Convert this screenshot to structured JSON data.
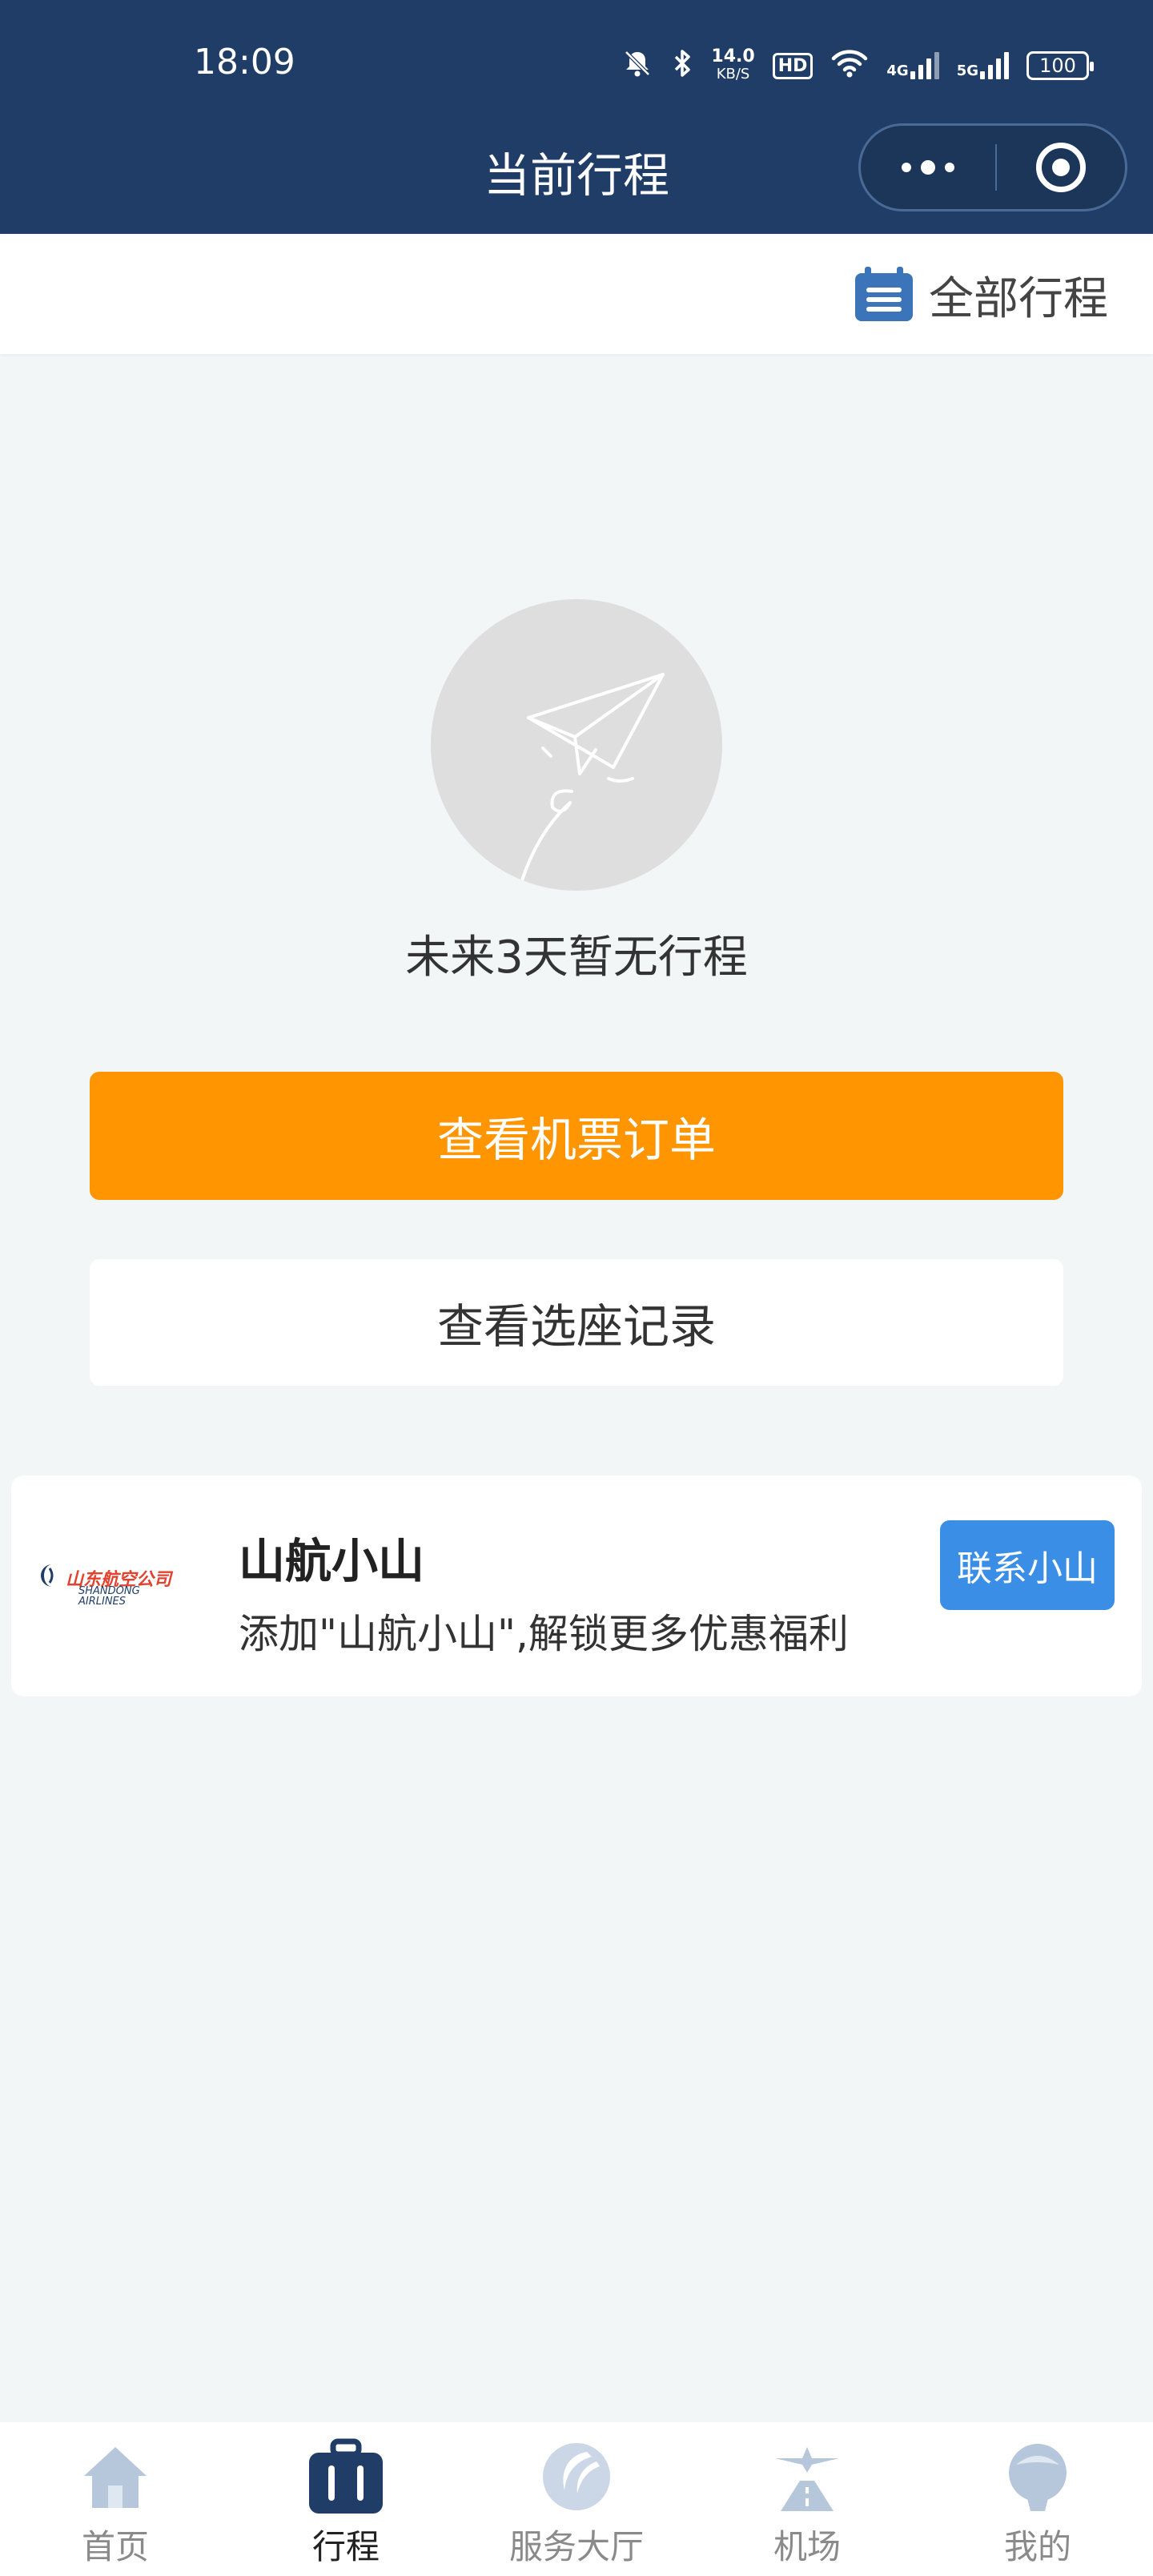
{
  "status_bar": {
    "time": "18:09",
    "net_speed_value": "14.0",
    "net_speed_unit": "KB/S",
    "hd_label": "HD",
    "signal_4g": "4G",
    "signal_5g": "5G",
    "battery": "100"
  },
  "header": {
    "title": "当前行程"
  },
  "subbar": {
    "all_trips_label": "全部行程"
  },
  "empty_state": {
    "message": "未来3天暂无行程"
  },
  "actions": {
    "view_orders_label": "查看机票订单",
    "view_seats_label": "查看选座记录"
  },
  "promo": {
    "logo_cn": "山东航空公司",
    "logo_en_line1": "SHANDONG",
    "logo_en_line2": "AIRLINES",
    "title": "山航小山",
    "description": "添加\"山航小山\",解锁更多优惠福利",
    "button_label": "联系小山"
  },
  "tabbar": {
    "items": [
      {
        "label": "首页",
        "icon": "home-icon",
        "active": false
      },
      {
        "label": "行程",
        "icon": "suitcase-icon",
        "active": true
      },
      {
        "label": "服务大厅",
        "icon": "service-hall-icon",
        "active": false
      },
      {
        "label": "机场",
        "icon": "airport-icon",
        "active": false
      },
      {
        "label": "我的",
        "icon": "profile-icon",
        "active": false
      }
    ]
  },
  "colors": {
    "header_bg": "#1f3d66",
    "primary_button": "#ff9500",
    "promo_button": "#3a8ee6",
    "page_bg": "#f2f6f7"
  }
}
